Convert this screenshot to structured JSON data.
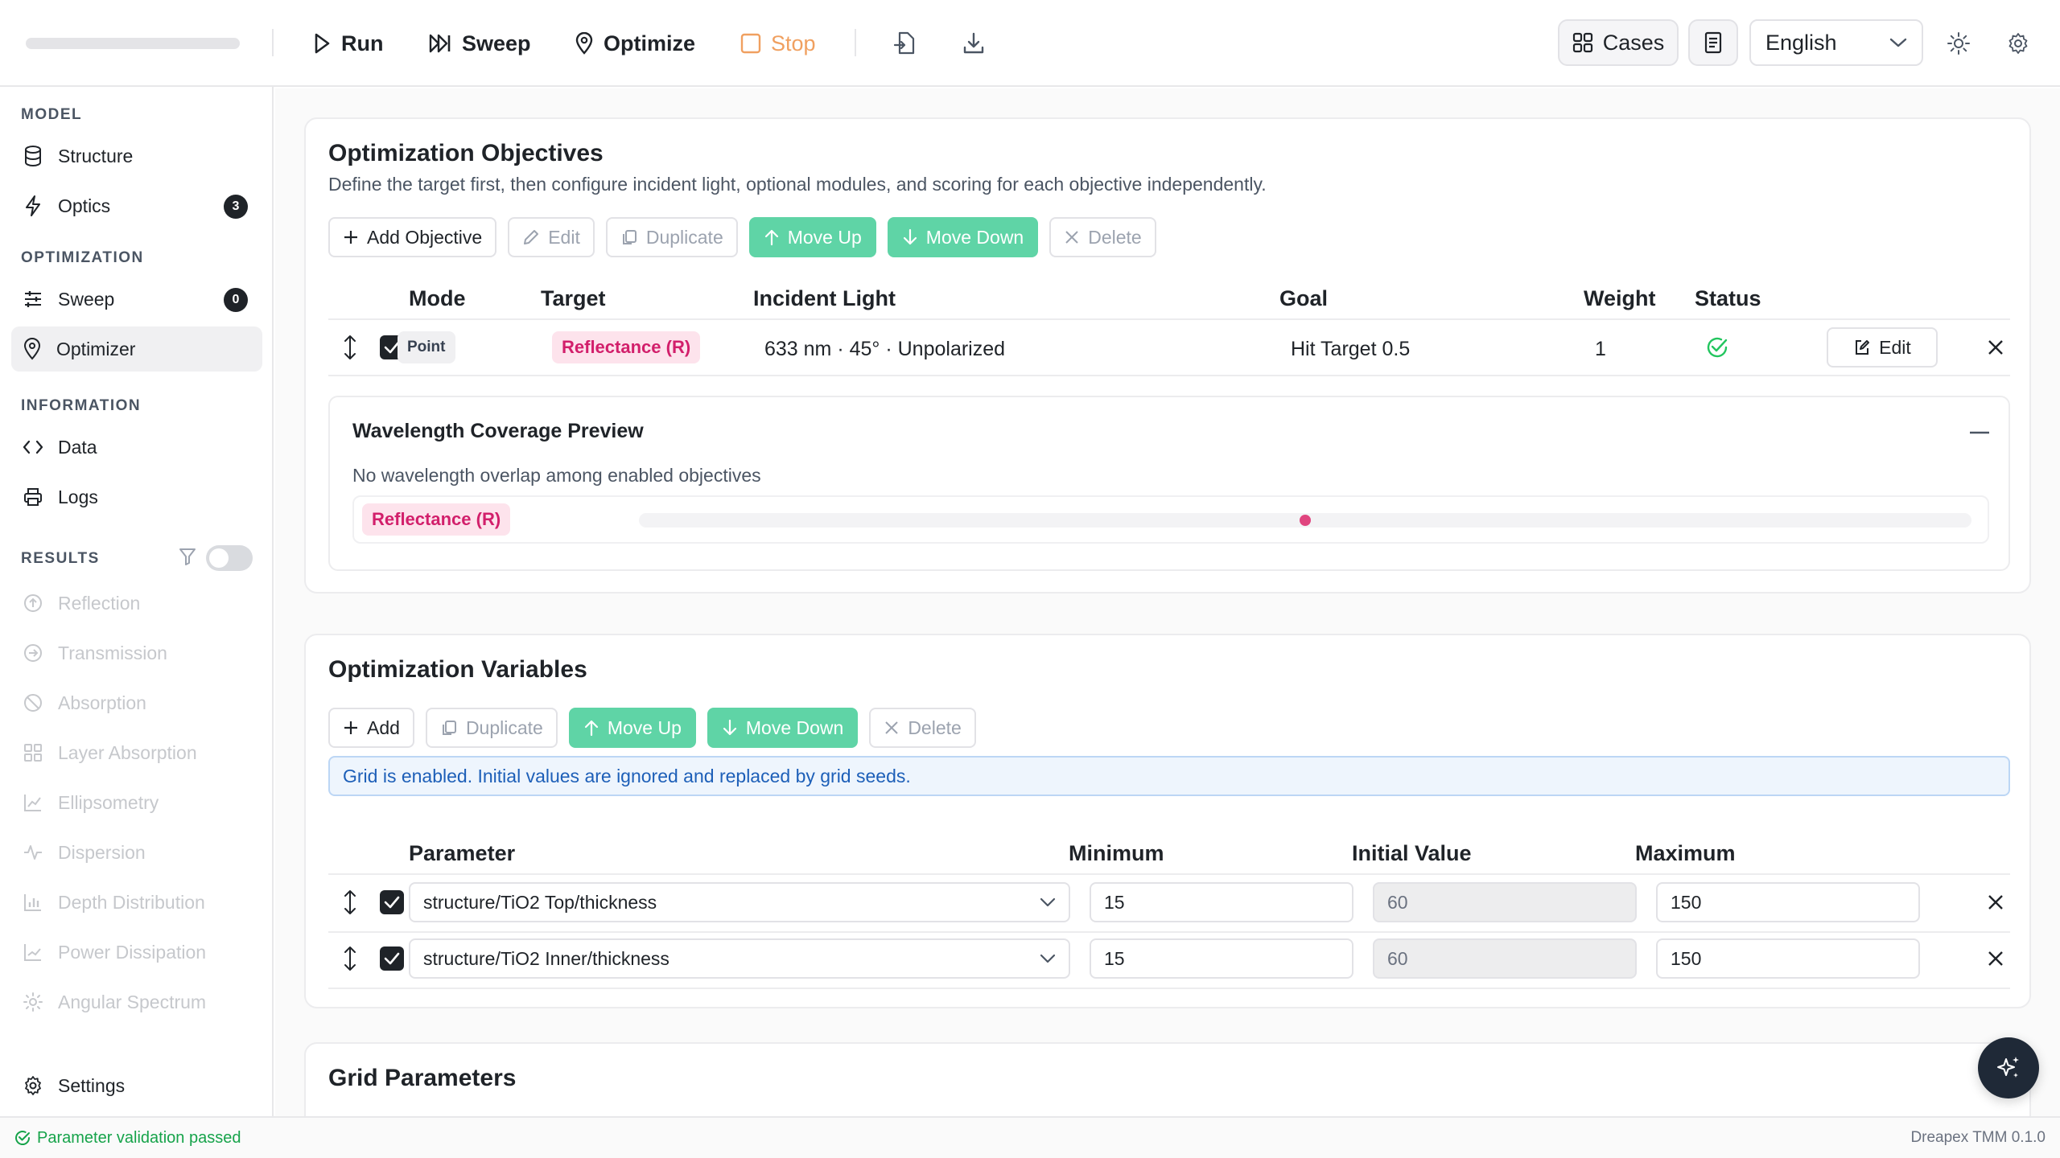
{
  "toolbar": {
    "run": "Run",
    "sweep": "Sweep",
    "optimize": "Optimize",
    "stop": "Stop",
    "cases": "Cases",
    "language": "English"
  },
  "sidebar": {
    "model_label": "MODEL",
    "structure": "Structure",
    "optics": "Optics",
    "optics_count": "3",
    "optimization_label": "OPTIMIZATION",
    "sweep": "Sweep",
    "sweep_count": "0",
    "optimizer": "Optimizer",
    "information_label": "INFORMATION",
    "data": "Data",
    "logs": "Logs",
    "results_label": "RESULTS",
    "results": [
      "Reflection",
      "Transmission",
      "Absorption",
      "Layer Absorption",
      "Ellipsometry",
      "Dispersion",
      "Depth Distribution",
      "Power Dissipation",
      "Angular Spectrum"
    ],
    "settings": "Settings"
  },
  "objectives": {
    "title": "Optimization Objectives",
    "description": "Define the target first, then configure incident light, optional modules, and scoring for each objective independently.",
    "buttons": {
      "add": "Add Objective",
      "edit": "Edit",
      "duplicate": "Duplicate",
      "move_up": "Move Up",
      "move_down": "Move Down",
      "delete": "Delete"
    },
    "columns": {
      "mode": "Mode",
      "target": "Target",
      "incident": "Incident Light",
      "goal": "Goal",
      "weight": "Weight",
      "status": "Status"
    },
    "row": {
      "mode": "Point",
      "target": "Reflectance (R)",
      "incident": "633 nm · 45° · Unpolarized",
      "goal": "Hit Target 0.5",
      "weight": "1",
      "edit": "Edit"
    },
    "coverage": {
      "title": "Wavelength Coverage Preview",
      "note": "No wavelength overlap among enabled objectives",
      "series": "Reflectance (R)",
      "point_position": 0.5
    }
  },
  "variables": {
    "title": "Optimization Variables",
    "buttons": {
      "add": "Add",
      "duplicate": "Duplicate",
      "move_up": "Move Up",
      "move_down": "Move Down",
      "delete": "Delete"
    },
    "banner": "Grid is enabled. Initial values are ignored and replaced by grid seeds.",
    "columns": {
      "parameter": "Parameter",
      "minimum": "Minimum",
      "initial": "Initial Value",
      "maximum": "Maximum"
    },
    "rows": [
      {
        "parameter": "structure/TiO2 Top/thickness",
        "min": "15",
        "initial": "60",
        "max": "150"
      },
      {
        "parameter": "structure/TiO2 Inner/thickness",
        "min": "15",
        "initial": "60",
        "max": "150"
      }
    ]
  },
  "grid": {
    "title": "Grid Parameters"
  },
  "status": {
    "message": "Parameter validation passed",
    "version": "Dreapex TMM 0.1.0"
  },
  "colors": {
    "accent_green": "#5fd4a6",
    "reflectance_pink": "#d21f6b",
    "stop_orange": "#f0a060",
    "info_blue": "#1d5fb8",
    "status_green": "#16a34a"
  },
  "icons": {
    "run": "play-icon",
    "sweep": "fast-forward-icon",
    "optimize": "map-pin-icon",
    "stop": "stop-square-icon",
    "import": "file-import-icon",
    "export": "download-icon",
    "cases": "grid-icon",
    "notes": "document-icon",
    "theme": "sun-icon",
    "settings": "gear-icon"
  }
}
